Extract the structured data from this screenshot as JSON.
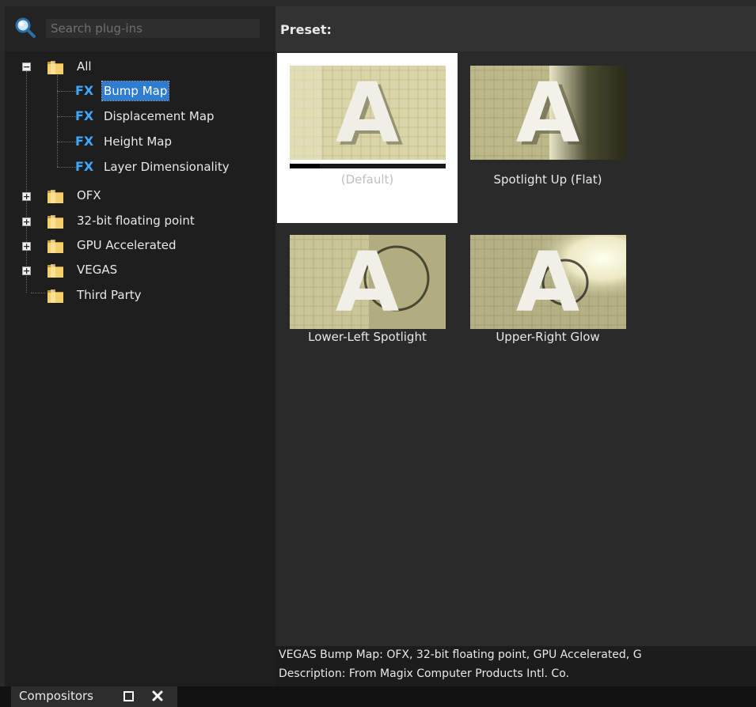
{
  "search": {
    "placeholder": "Search plug-ins"
  },
  "tree": {
    "all": "All",
    "children": [
      "Bump Map",
      "Displacement Map",
      "Height Map",
      "Layer Dimensionality"
    ],
    "folders": [
      "OFX",
      "32-bit floating point",
      "GPU Accelerated",
      "VEGAS",
      "Third Party"
    ],
    "selected": "Bump Map",
    "fx_badge": "FX"
  },
  "preset": {
    "title": "Preset:",
    "items": [
      {
        "label": "(Default)",
        "selected": true
      },
      {
        "label": "Spotlight Up (Flat)"
      },
      {
        "label": "Lower-Left Spotlight"
      },
      {
        "label": "Upper-Right Glow"
      }
    ],
    "thumb_letter": "A"
  },
  "status": {
    "line1": "VEGAS Bump Map: OFX, 32-bit floating point, GPU Accelerated, G",
    "line2": "Description: From Magix Computer Products Intl. Co."
  },
  "tab": {
    "label": "Compositors"
  },
  "colors": {
    "accent": "#2e7dd1",
    "fx_blue": "#3da8ff",
    "folder": "#e8c460"
  },
  "icons": [
    "search-icon",
    "folder-icon",
    "fx-icon",
    "expand-icon",
    "collapse-icon",
    "restore-icon",
    "close-icon"
  ]
}
